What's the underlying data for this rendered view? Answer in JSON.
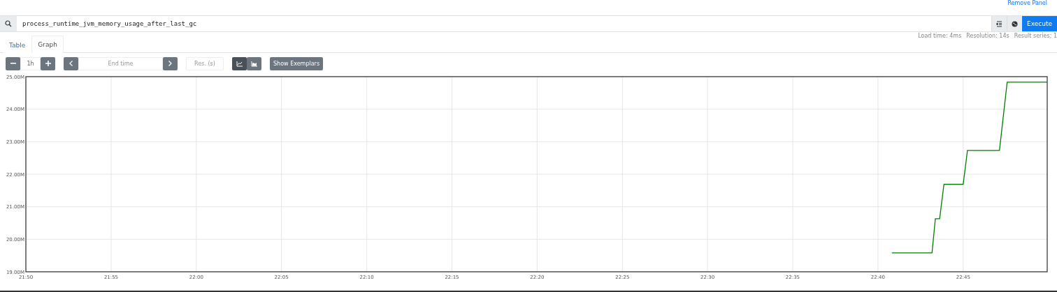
{
  "remove_panel": "Remove Panel",
  "query": {
    "value": "process_runtime_jvm_memory_usage_after_last_gc"
  },
  "execute": "Execute",
  "stats": [
    "Load time: 4ms",
    "Resolution: 14s",
    "Result series: 1"
  ],
  "tabs": [
    {
      "label": "Table",
      "selected": false
    },
    {
      "label": "Graph",
      "selected": true
    }
  ],
  "controls": {
    "range": "1h",
    "end_time_placeholder": "End time",
    "resolution_placeholder": "Res. (s)",
    "chart_modes": [
      {
        "kind": "lines",
        "selected": true
      },
      {
        "kind": "stacked",
        "selected": false
      }
    ],
    "exemplars_button": "Show Exemplars"
  },
  "graph": {
    "chart_data": {
      "type": "line",
      "grid": true,
      "xlim": [
        21.8333,
        22.8322
      ],
      "ylim": [
        19,
        25
      ],
      "yticks": [
        {
          "value": 19,
          "label": "19.00M"
        },
        {
          "value": 20,
          "label": "20.00M"
        },
        {
          "value": 21,
          "label": "21.00M"
        },
        {
          "value": 22,
          "label": "22.00M"
        },
        {
          "value": 23,
          "label": "23.00M"
        },
        {
          "value": 24,
          "label": "24.00M"
        },
        {
          "value": 25,
          "label": "25.00M"
        }
      ],
      "xticks": [
        {
          "value": 21.8333,
          "label": "21:50"
        },
        {
          "value": 21.9167,
          "label": "21:55"
        },
        {
          "value": 22.0,
          "label": "22:00"
        },
        {
          "value": 22.0833,
          "label": "22:05"
        },
        {
          "value": 22.1667,
          "label": "22:10"
        },
        {
          "value": 22.25,
          "label": "22:15"
        },
        {
          "value": 22.3333,
          "label": "22:20"
        },
        {
          "value": 22.4167,
          "label": "22:25"
        },
        {
          "value": 22.5,
          "label": "22:30"
        },
        {
          "value": 22.5833,
          "label": "22:35"
        },
        {
          "value": 22.6667,
          "label": "22:40"
        },
        {
          "value": 22.75,
          "label": "22:45"
        }
      ],
      "x": [
        22.6803,
        22.7195,
        22.7228,
        22.727,
        22.7312,
        22.75,
        22.7542,
        22.7855,
        22.793,
        22.8322
      ],
      "series": [
        {
          "color": "#008000",
          "values": [
            19.58,
            19.58,
            20.63,
            20.63,
            21.69,
            21.69,
            22.73,
            22.73,
            24.83,
            24.83
          ]
        }
      ]
    }
  }
}
